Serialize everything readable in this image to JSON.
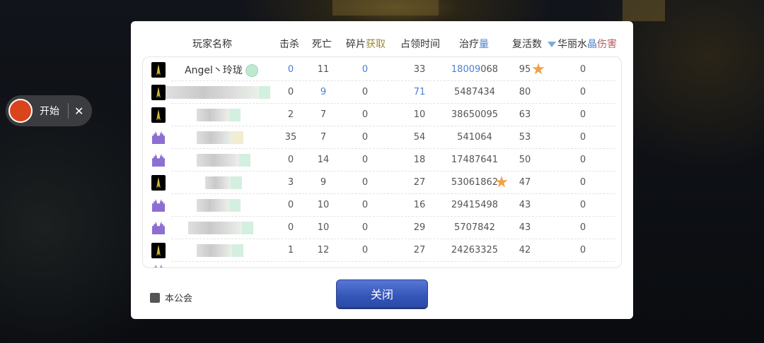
{
  "recorder": {
    "start_label": "开始",
    "close_glyph": "✕"
  },
  "table": {
    "headers": {
      "name": "玩家名称",
      "kills": "击杀",
      "deaths": "死亡",
      "fragments_a": "碎片",
      "fragments_b": "获取",
      "occupy_time": "占领时间",
      "healing_a": "治疗",
      "healing_b": "量",
      "revives": "复活数",
      "crystal_a": "华丽水",
      "crystal_b": "晶",
      "crystal_c": "伤害"
    },
    "rows": [
      {
        "class": "blade",
        "name": "Angel丶玲珑",
        "kills": "0",
        "deaths": "11",
        "fragments": "0",
        "occupy": "33",
        "healing_a": "18009",
        "healing_b": "068",
        "revives": "95",
        "star_on": "revives",
        "crystal": "0"
      },
      {
        "class": "blade",
        "name": "",
        "kills": "0",
        "deaths": "9",
        "fragments": "0",
        "occupy": "71",
        "healing": "5487434",
        "revives": "80",
        "crystal": "0"
      },
      {
        "class": "blade",
        "name": "",
        "kills": "2",
        "deaths": "7",
        "fragments": "0",
        "occupy": "10",
        "healing": "38650095",
        "revives": "63",
        "crystal": "0"
      },
      {
        "class": "castle",
        "name": "",
        "kills": "35",
        "deaths": "7",
        "fragments": "0",
        "occupy": "54",
        "healing": "541064",
        "revives": "53",
        "crystal": "0"
      },
      {
        "class": "castle",
        "name": "",
        "kills": "0",
        "deaths": "14",
        "fragments": "0",
        "occupy": "18",
        "healing": "17487641",
        "revives": "50",
        "crystal": "0"
      },
      {
        "class": "blade",
        "name": "",
        "kills": "3",
        "deaths": "9",
        "fragments": "0",
        "occupy": "27",
        "healing": "53061862",
        "star_on": "healing",
        "revives": "47",
        "crystal": "0"
      },
      {
        "class": "castle",
        "name": "",
        "kills": "0",
        "deaths": "10",
        "fragments": "0",
        "occupy": "16",
        "healing": "29415498",
        "revives": "43",
        "crystal": "0"
      },
      {
        "class": "castle",
        "name": "",
        "kills": "0",
        "deaths": "10",
        "fragments": "0",
        "occupy": "29",
        "healing": "5707842",
        "revives": "43",
        "crystal": "0"
      },
      {
        "class": "blade",
        "name": "",
        "kills": "1",
        "deaths": "12",
        "fragments": "0",
        "occupy": "27",
        "healing": "24263325",
        "revives": "42",
        "crystal": "0"
      }
    ]
  },
  "footer": {
    "guild_filter_label": "本公会",
    "close_button": "关闭"
  },
  "colors": {
    "accent_blue": "#3456b8",
    "record_red": "#d9441c",
    "star_orange": "#f2a04a"
  }
}
